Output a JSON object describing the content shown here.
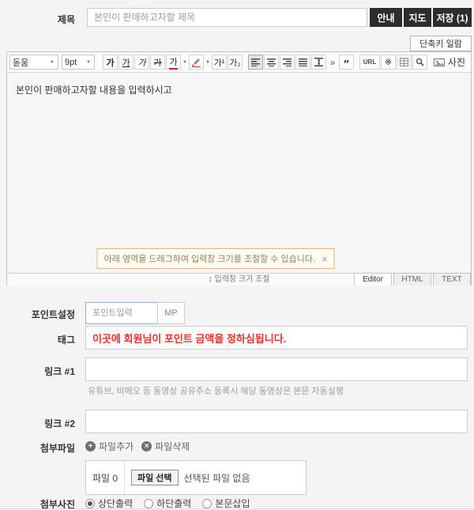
{
  "header": {
    "title_label": "제목",
    "title_placeholder": "본인이 판매하고자할 제목",
    "buttons": [
      {
        "label": "안내"
      },
      {
        "label": "지도"
      },
      {
        "label": "저장 (1)"
      }
    ],
    "shortcut_button_label": "단축키 일람"
  },
  "icons": {
    "dropdown_arrow": "▼",
    "resize_arrows": "↕",
    "quote": "“",
    "more": "»",
    "add_glyph": "+",
    "delete_glyph": "×"
  },
  "editor": {
    "toolbar": {
      "font_family": "돋움",
      "font_size": "9pt",
      "format_buttons": [
        {
          "name": "bold",
          "label": "가"
        },
        {
          "name": "underline",
          "label": "가"
        },
        {
          "name": "italic",
          "label": "가"
        },
        {
          "name": "strikethrough",
          "label": "가"
        },
        {
          "name": "font-color",
          "label": "가"
        },
        {
          "name": "superscript",
          "label": "가¹"
        },
        {
          "name": "subscript",
          "label": "가₂"
        }
      ],
      "url_button": "URL",
      "special_char_button": "※",
      "photo_button": "사진"
    },
    "content_text": "본인이 판매하고자할 내용을 입력하시고",
    "tooltip": {
      "text": "아래 영역을 드래그하여 입력창 크기를 조절할 수 있습니다.",
      "close": "×"
    },
    "resize_label": "입력창 크기 조절",
    "tabs": [
      {
        "label": "Editor",
        "active": true
      },
      {
        "label": "HTML",
        "active": false
      },
      {
        "label": "TEXT",
        "active": false
      }
    ]
  },
  "form": {
    "point": {
      "label": "포인트설정",
      "placeholder": "포인트입력",
      "unit": "MP"
    },
    "tag": {
      "label": "태그",
      "value": "이곳에 회원님이 포인트 금액을 정하심됩니다.",
      "value_color": "#e8302a"
    },
    "link1": {
      "label": "링크 #1",
      "help": "유튜브, 비메오 등 동영상 공유주소 등록시 해당 동영상은 본문 자동실행"
    },
    "link2": {
      "label": "링크 #2"
    },
    "attachment": {
      "label": "첨부파일",
      "add_label": "파일추가",
      "delete_label": "파일삭제",
      "file_count_label": "파일 0",
      "choose_button": "파일 선택",
      "no_file_text": "선택된 파일 없음"
    },
    "photo": {
      "label": "첨부사진",
      "options": [
        {
          "label": "상단출력",
          "selected": true
        },
        {
          "label": "하단출력",
          "selected": false
        },
        {
          "label": "본문삽입",
          "selected": false
        }
      ]
    }
  },
  "colors": {
    "accent_dark": "#2d2d2d",
    "red_text": "#e8302a",
    "page_bg": "#f4f4f4"
  }
}
